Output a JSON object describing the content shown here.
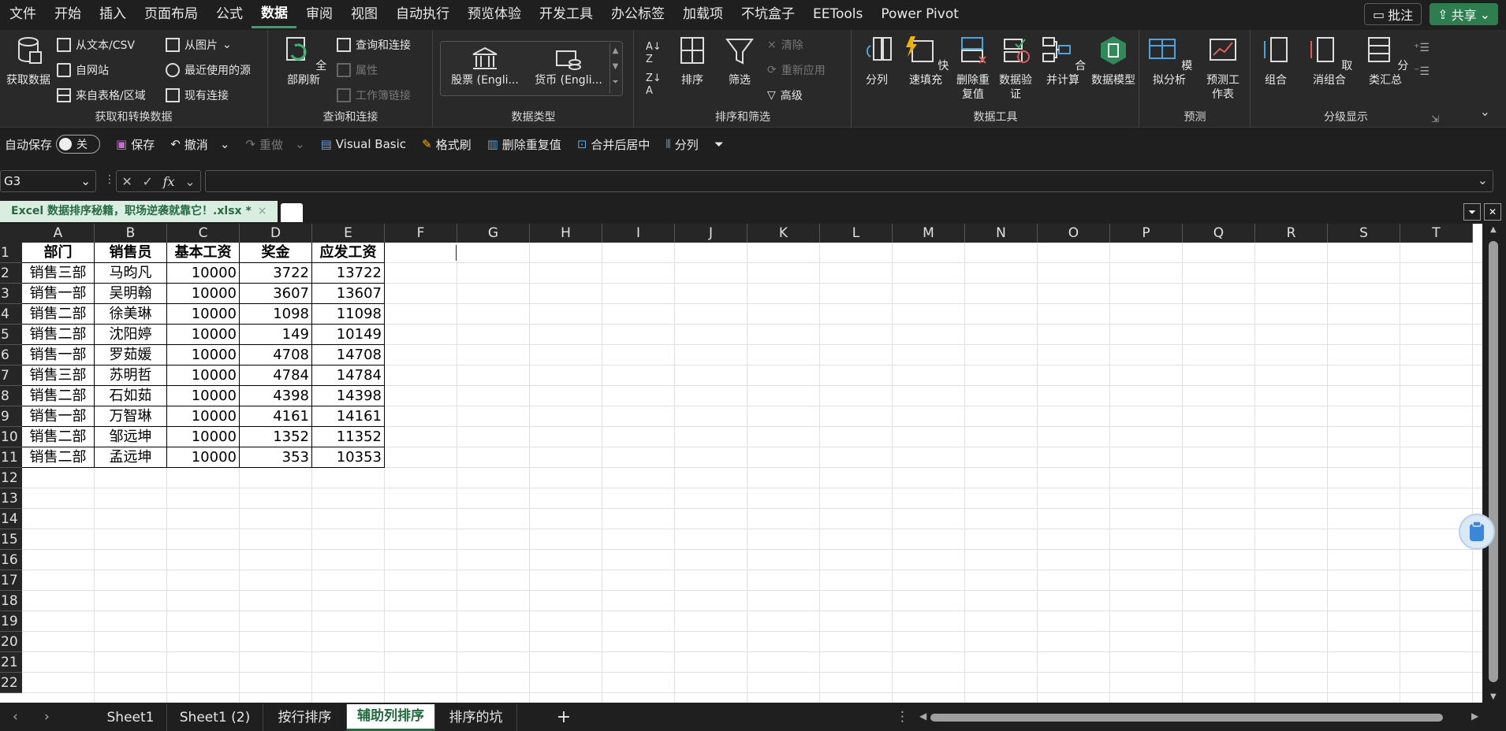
{
  "menubar": {
    "items": [
      "文件",
      "开始",
      "插入",
      "页面布局",
      "公式",
      "数据",
      "审阅",
      "视图",
      "自动执行",
      "预览体验",
      "开发工具",
      "办公标签",
      "加载项",
      "不坑盒子",
      "EETools",
      "Power Pivot"
    ],
    "active": "数据",
    "comment_label": "批注",
    "share_label": "共享"
  },
  "ribbon": {
    "get_data": {
      "label": "获取数据",
      "from_text": "从文本/CSV",
      "from_web": "自网站",
      "from_table": "来自表格/区域",
      "from_picture": "从图片",
      "recent_sources": "最近使用的源",
      "existing_conn": "现有连接",
      "group_label": "获取和转换数据"
    },
    "query": {
      "refresh_all": "全部刷新",
      "queries_conn": "查询和连接",
      "properties": "属性",
      "workbook_links": "工作簿链接",
      "group_label": "查询和连接"
    },
    "datatypes": {
      "stocks": "股票 (Engli...",
      "currency": "货币 (Engli...",
      "group_label": "数据类型"
    },
    "sort_filter": {
      "sort": "排序",
      "filter": "筛选",
      "clear": "清除",
      "reapply": "重新应用",
      "advanced": "高级",
      "group_label": "排序和筛选"
    },
    "data_tools": {
      "split": "分列",
      "flash_fill": "快速填充",
      "remove_dup": "删除重复值",
      "validate": "数据验证",
      "consolidate": "合并计算",
      "data_model": "数据模型",
      "group_label": "数据工具"
    },
    "forecast": {
      "whatif": "模拟分析",
      "forecast_sheet": "预测工作表",
      "group_label": "预测"
    },
    "outline": {
      "group": "组合",
      "ungroup": "取消组合",
      "subtotal": "分类汇总",
      "group_label": "分级显示"
    }
  },
  "qat": {
    "autosave": "自动保存",
    "toggle_state": "关",
    "save": "保存",
    "undo": "撤消",
    "redo": "重做",
    "visual_basic": "Visual Basic",
    "format_painter": "格式刷",
    "remove_dup": "删除重复值",
    "merge_center": "合并后居中",
    "split": "分列"
  },
  "formula_bar": {
    "name_box": "G3",
    "fx": "fx",
    "value": ""
  },
  "doc_tab": {
    "title": "Excel 数据排序秘籍，职场逆袭就靠它！.xlsx *"
  },
  "sheet": {
    "columns": [
      "A",
      "B",
      "C",
      "D",
      "E",
      "F",
      "G",
      "H",
      "I",
      "J",
      "K",
      "L",
      "M",
      "N",
      "O",
      "P",
      "Q",
      "R",
      "S",
      "T"
    ],
    "rows": [
      "1",
      "2",
      "3",
      "4",
      "5",
      "6",
      "7",
      "8",
      "9",
      "10",
      "11",
      "12",
      "13",
      "14",
      "15",
      "16",
      "17",
      "18",
      "19",
      "20",
      "21",
      "22"
    ],
    "headers": [
      "部门",
      "销售员",
      "基本工资",
      "奖金",
      "应发工资"
    ],
    "data": [
      [
        "销售三部",
        "马昀凡",
        "10000",
        "3722",
        "13722"
      ],
      [
        "销售一部",
        "吴明翰",
        "10000",
        "3607",
        "13607"
      ],
      [
        "销售二部",
        "徐美琳",
        "10000",
        "1098",
        "11098"
      ],
      [
        "销售二部",
        "沈阳婷",
        "10000",
        "149",
        "10149"
      ],
      [
        "销售一部",
        "罗茹媛",
        "10000",
        "4708",
        "14708"
      ],
      [
        "销售三部",
        "苏明哲",
        "10000",
        "4784",
        "14784"
      ],
      [
        "销售二部",
        "石如茹",
        "10000",
        "4398",
        "14398"
      ],
      [
        "销售一部",
        "万智琳",
        "10000",
        "4161",
        "14161"
      ],
      [
        "销售二部",
        "邹远坤",
        "10000",
        "1352",
        "11352"
      ],
      [
        "销售二部",
        "孟远坤",
        "10000",
        "353",
        "10353"
      ]
    ]
  },
  "sheet_tabs": {
    "tabs": [
      "Sheet1",
      "Sheet1 (2)",
      "按行排序",
      "辅助列排序",
      "排序的坑"
    ],
    "active": "辅助列排序",
    "add": "+"
  }
}
